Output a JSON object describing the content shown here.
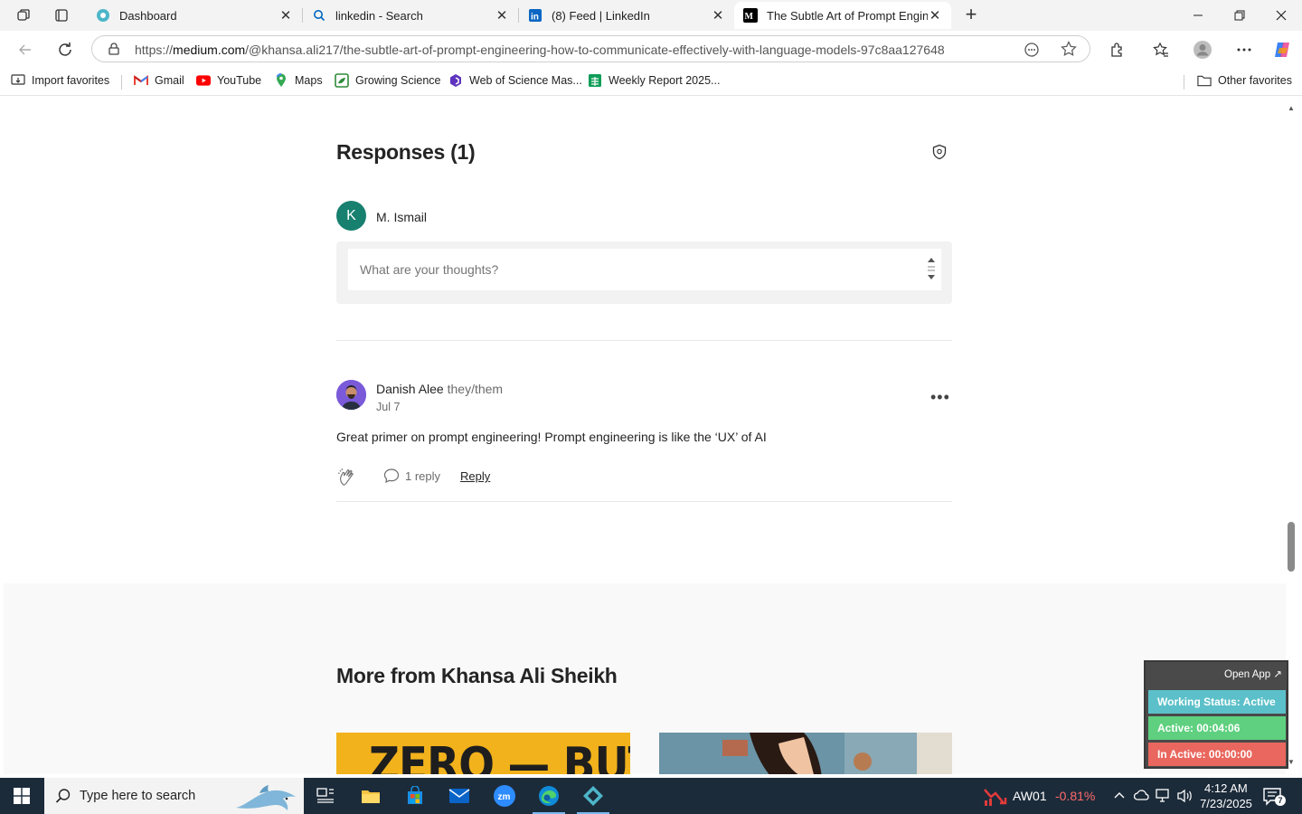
{
  "browser": {
    "tabs": [
      {
        "title": "Dashboard"
      },
      {
        "title": "linkedin - Search"
      },
      {
        "title": "(8) Feed | LinkedIn"
      },
      {
        "title": "The Subtle Art of Prompt Enginee"
      }
    ],
    "url_prefix": "https://",
    "url_domain": "medium.com",
    "url_path": "/@khansa.ali217/the-subtle-art-of-prompt-engineering-how-to-communicate-effectively-with-language-models-97c8aa127648",
    "favorites": [
      {
        "label": "Import favorites",
        "icon": "import-icon"
      },
      {
        "label": "Gmail",
        "icon": "gmail-icon"
      },
      {
        "label": "YouTube",
        "icon": "youtube-icon"
      },
      {
        "label": "Maps",
        "icon": "maps-icon"
      },
      {
        "label": "Growing Science",
        "icon": "growing-science-icon"
      },
      {
        "label": "Web of Science Mas...",
        "icon": "web-of-science-icon"
      },
      {
        "label": "Weekly Report 2025...",
        "icon": "sheets-icon"
      }
    ],
    "other_favorites": "Other favorites"
  },
  "page": {
    "responses_title": "Responses (1)",
    "current_user": {
      "initial": "K",
      "name": "M. Ismail"
    },
    "reply_placeholder": "What are your thoughts?",
    "comment": {
      "author": "Danish Alee",
      "pronouns": "they/them",
      "date": "Jul 7",
      "body": "Great primer on prompt engineering! Prompt engineering is like the ‘UX’ of AI",
      "more": "•••",
      "reply_count": "1 reply",
      "reply_label": "Reply"
    },
    "more_from_title": "More from Khansa Ali Sheikh",
    "card1_text": "ZERO — BUT"
  },
  "widget": {
    "open_app": "Open App ↗",
    "working_status": "Working Status: Active",
    "active": "Active: 00:04:06",
    "inactive": "In Active: 00:00:00",
    "colors": {
      "status": "#5bc0c9",
      "active": "#5fd07f",
      "inactive": "#e9675e"
    }
  },
  "taskbar": {
    "search_placeholder": "Type here to search",
    "stock_symbol": "AW01",
    "stock_change": "-0.81%",
    "time": "4:12 AM",
    "date": "7/23/2025",
    "notifications": "7"
  }
}
